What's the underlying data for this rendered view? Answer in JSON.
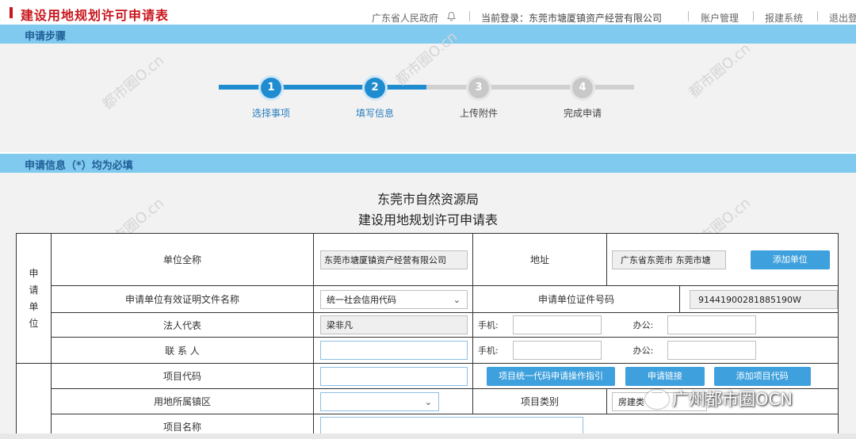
{
  "header": {
    "title": "建设用地规划许可申请表",
    "province": "广东省人民政府",
    "login": "当前登录：东莞市塘厦镇资产经营有限公司",
    "account": "账户管理",
    "report_system": "报建系统",
    "logout": "退出登"
  },
  "steps_bar": {
    "title": "申请步骤"
  },
  "steps": [
    {
      "num": "1",
      "label": "选择事项",
      "state": "done"
    },
    {
      "num": "2",
      "label": "填写信息",
      "state": "active"
    },
    {
      "num": "3",
      "label": "上传附件",
      "state": "pending"
    },
    {
      "num": "4",
      "label": "完成申请",
      "state": "pending"
    }
  ],
  "info_bar": {
    "title": "申请信息（*）均为必填"
  },
  "form_title": {
    "org": "东莞市自然资源局",
    "name": "建设用地规划许可申请表"
  },
  "applicant": {
    "group_label": "申请单位",
    "unit_name_label": "单位全称",
    "unit_name_value": "东莞市塘厦镇资产经营有限公司",
    "address_label": "地址",
    "address_value": "广东省东莞市 东莞市塘",
    "add_unit": "添加单位",
    "doc_label": "申请单位有效证明文件名称",
    "doc_value": "统一社会信用代码",
    "cert_label": "申请单位证件号码",
    "cert_value": "91441900281885190W",
    "legal_label": "法人代表",
    "legal_value": "梁非凡",
    "mobile_label": "手机:",
    "office_label": "办公:",
    "contact_label": "联 系 人",
    "mobile2_label": "手机:",
    "office2_label": "办公:"
  },
  "project": {
    "code_label": "项目代码",
    "code_guide": "项目统一代码申请操作指引",
    "apply_link": "申请链接",
    "add_code": "添加项目代码",
    "town_label": "用地所属镇区",
    "type_label": "项目类别",
    "type_value": "房建类",
    "name_label": "项目名称"
  },
  "watermark": "都市圈O.cn",
  "badge": "广州都市圈OCN",
  "colors": {
    "brand_red": "#c8161d",
    "bar_blue": "#80c9ef",
    "accent_blue": "#1f8ccf",
    "button_blue": "#3ea0dd"
  }
}
